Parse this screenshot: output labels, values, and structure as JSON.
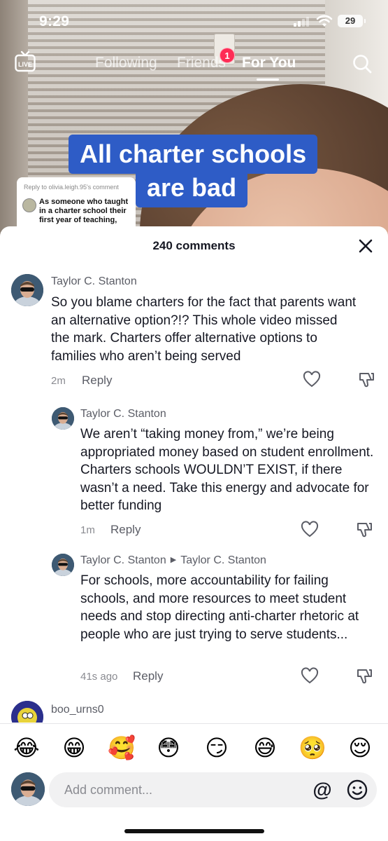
{
  "status_bar": {
    "time": "9:29",
    "battery": "29"
  },
  "top_nav": {
    "live_label": "LIVE",
    "tabs": [
      {
        "label": "Following",
        "active": false
      },
      {
        "label": "Friends",
        "active": false,
        "badge": "1"
      },
      {
        "label": "For You",
        "active": true
      }
    ]
  },
  "video": {
    "caption_lines": [
      "All charter schools",
      "are bad"
    ],
    "reply_sticker": {
      "label": "Reply to olivia.leigh.95's comment",
      "text": "As someone who taught in a charter school their first year of teaching,"
    }
  },
  "comments_sheet": {
    "title": "240 comments",
    "comments": [
      {
        "author": "Taylor C. Stanton",
        "text": "So you blame charters for the fact that parents want an alternative option?!? This whole video missed the mark. Charters offer alternative options to families who aren’t being served",
        "time": "2m",
        "reply_label": "Reply"
      },
      {
        "author": "Taylor C. Stanton",
        "text": "We aren’t “taking money from,” we’re being appropriated money based on student enrollment. Charters schools WOULDN’T EXIST, if there wasn’t a need. Take this energy and advocate for better funding",
        "time": "1m",
        "reply_label": "Reply"
      },
      {
        "author": "Taylor C. Stanton",
        "reply_to": "Taylor C. Stanton",
        "text": "For schools, more accountability for failing schools, and more resources to meet student needs and stop directing anti-charter rhetoric at people who are just trying to serve students...",
        "time": "41s ago",
        "reply_label": "Reply"
      },
      {
        "author": "boo_urns0"
      }
    ],
    "emojis": [
      "😂",
      "😁",
      "🥰",
      "😳",
      "😏",
      "😅",
      "🥺",
      "😌"
    ],
    "input": {
      "placeholder": "Add comment...",
      "mention_symbol": "@"
    }
  }
}
